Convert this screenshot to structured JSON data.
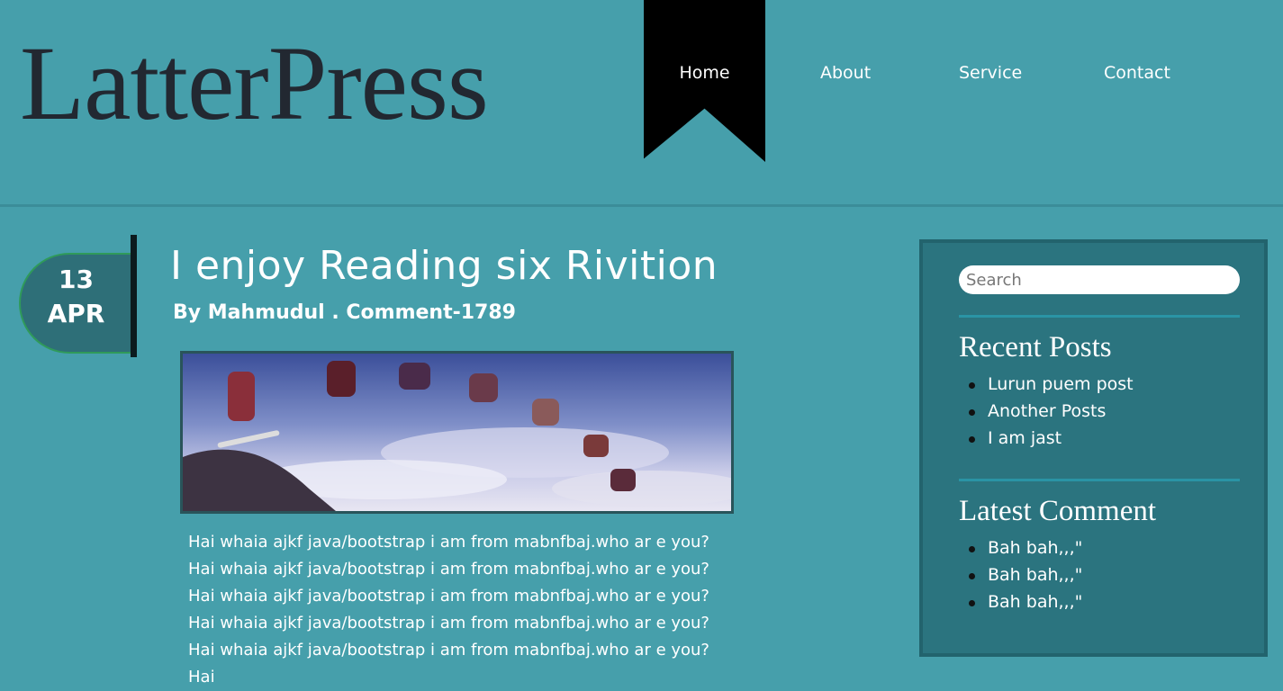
{
  "header": {
    "logo": "LatterPress",
    "nav": [
      "Home",
      "About",
      "Service",
      "Contact"
    ],
    "active_nav": "Home"
  },
  "post": {
    "date_day": "13",
    "date_month": "APR",
    "title": "I enjoy Reading six Rivition",
    "meta": "By Mahmudul . Comment-1789",
    "body": "Hai whaia ajkf java/bootstrap i am from mabnfbaj.who ar e you? Hai whaia ajkf java/bootstrap i am from mabnfbaj.who ar e you? Hai whaia ajkf java/bootstrap i am from mabnfbaj.who ar e you? Hai whaia ajkf java/bootstrap i am from mabnfbaj.who ar e you? Hai whaia ajkf java/bootstrap i am from mabnfbaj.who ar e you? Hai"
  },
  "sidebar": {
    "search_placeholder": "Search",
    "recent_heading": "Recent Posts",
    "recent_posts": [
      "Lurun puem post",
      "Another Posts",
      "I am jast"
    ],
    "comments_heading": "Latest Comment",
    "latest_comments": [
      "Bah bah,,,\"",
      "Bah bah,,,\"",
      "Bah bah,,,\""
    ]
  },
  "colors": {
    "page_background": "#469fab",
    "sidebar_background": "#2b747f",
    "logo_text": "#222831",
    "nav_ribbon": "#000000"
  }
}
